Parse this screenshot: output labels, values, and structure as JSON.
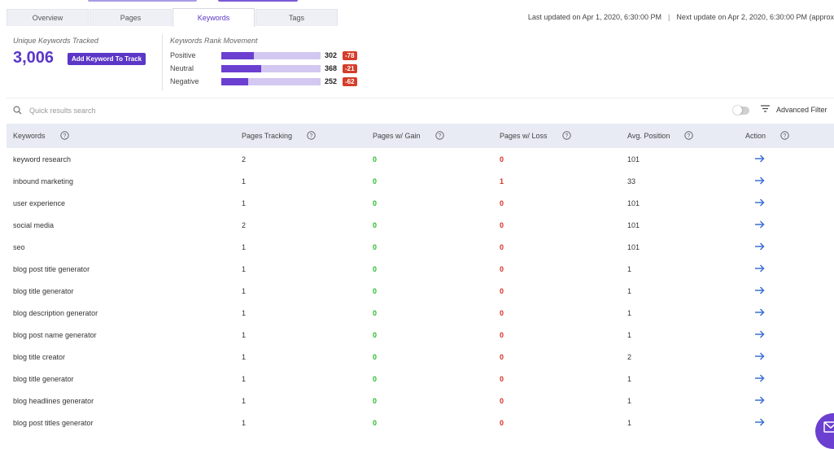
{
  "tabs": [
    {
      "label": "Overview",
      "active": false
    },
    {
      "label": "Pages",
      "active": false
    },
    {
      "label": "Keywords",
      "active": true
    },
    {
      "label": "Tags",
      "active": false
    }
  ],
  "update_info": {
    "last": "Last updated on Apr 1, 2020, 6:30:00 PM",
    "separator": "|",
    "next": "Next update on Apr 2, 2020, 6:30:00 PM (approx"
  },
  "unique_keywords": {
    "label": "Unique Keywords Tracked",
    "count": "3,006",
    "add_button": "Add Keyword To Track"
  },
  "rank_movement": {
    "label": "Keywords Rank Movement",
    "rows": [
      {
        "name": "Positive",
        "value": "302",
        "delta": "-78",
        "fill": 0.33
      },
      {
        "name": "Neutral",
        "value": "368",
        "delta": "-21",
        "fill": 0.4
      },
      {
        "name": "Negative",
        "value": "252",
        "delta": "-62",
        "fill": 0.27
      }
    ]
  },
  "search": {
    "placeholder": "Quick results search",
    "value": ""
  },
  "advanced_filter": "Advanced Filter",
  "table": {
    "columns": [
      "Keywords",
      "Pages Tracking",
      "Pages w/ Gain",
      "Pages w/ Loss",
      "Avg. Position",
      "Action"
    ],
    "rows": [
      {
        "keyword": "keyword research",
        "tracking": "2",
        "gain": "0",
        "loss": "0",
        "avg": "101"
      },
      {
        "keyword": "inbound marketing",
        "tracking": "1",
        "gain": "0",
        "loss": "1",
        "avg": "33"
      },
      {
        "keyword": "user experience",
        "tracking": "1",
        "gain": "0",
        "loss": "0",
        "avg": "101"
      },
      {
        "keyword": "social media",
        "tracking": "2",
        "gain": "0",
        "loss": "0",
        "avg": "101"
      },
      {
        "keyword": "seo",
        "tracking": "1",
        "gain": "0",
        "loss": "0",
        "avg": "101"
      },
      {
        "keyword": "blog post title generator",
        "tracking": "1",
        "gain": "0",
        "loss": "0",
        "avg": "1"
      },
      {
        "keyword": "blog title generator",
        "tracking": "1",
        "gain": "0",
        "loss": "0",
        "avg": "1"
      },
      {
        "keyword": "blog description generator",
        "tracking": "1",
        "gain": "0",
        "loss": "0",
        "avg": "1"
      },
      {
        "keyword": "blog post name generator",
        "tracking": "1",
        "gain": "0",
        "loss": "0",
        "avg": "1"
      },
      {
        "keyword": "blog title creator",
        "tracking": "1",
        "gain": "0",
        "loss": "0",
        "avg": "2"
      },
      {
        "keyword": "blog title generator",
        "tracking": "1",
        "gain": "0",
        "loss": "0",
        "avg": "1"
      },
      {
        "keyword": "blog headlines generator",
        "tracking": "1",
        "gain": "0",
        "loss": "0",
        "avg": "1"
      },
      {
        "keyword": "blog post titles generator",
        "tracking": "1",
        "gain": "0",
        "loss": "0",
        "avg": "1"
      }
    ]
  },
  "colors": {
    "accent": "#5b36c7",
    "gain": "#2eb82e",
    "loss": "#d93025",
    "delta_badge": "#d43d2a",
    "header_bg": "#e8eaf4"
  }
}
